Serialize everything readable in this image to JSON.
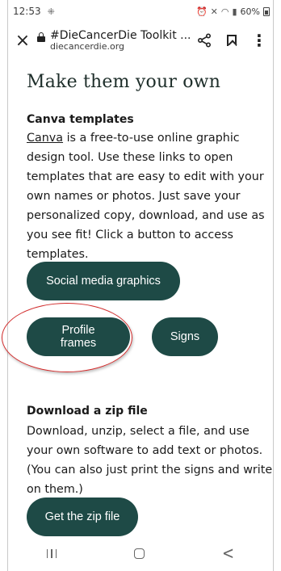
{
  "status_bar": {
    "time": "12:53",
    "battery": "60%"
  },
  "toolbar": {
    "close_label": "×",
    "page_title": "#DieCancerDie Toolkit ...",
    "domain": "diecancerdie.org",
    "kebab": "⋮"
  },
  "content": {
    "heading": "Make them your own",
    "canva": {
      "title": "Canva templates",
      "link_text": "Canva",
      "body": " is a free-to-use online graphic design tool. Use these links to open templates that are easy to edit with your own names or photos. Just save your personalized copy, download, and use as you see fit! Click a button to access templates."
    },
    "buttons": {
      "social": "Social media graphics",
      "profile": "Profile frames",
      "signs": "Signs"
    },
    "zip": {
      "title": "Download a zip file",
      "body": "Download, unzip, select a file, and use your own software to add text or photos. (You can also just print the signs and write on them.)",
      "button": "Get the zip file"
    }
  },
  "nav": {
    "back": "<"
  },
  "colors": {
    "button_bg": "#1e4a46",
    "annotation": "#d22a2a"
  }
}
